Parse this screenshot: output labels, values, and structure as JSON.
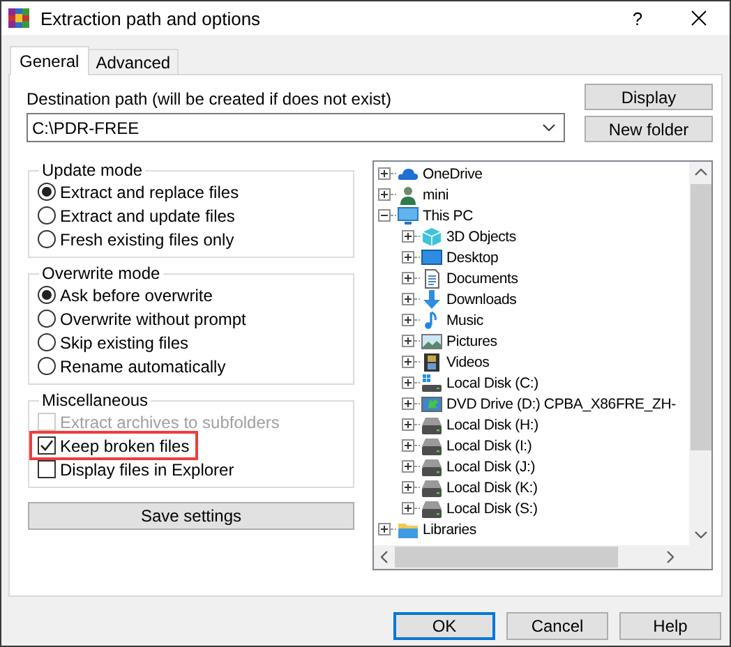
{
  "window": {
    "title": "Extraction path and options",
    "help": "?"
  },
  "tabs": [
    {
      "label": "General",
      "selected": true
    },
    {
      "label": "Advanced",
      "selected": false
    }
  ],
  "destination": {
    "label": "Destination path (will be created if does not exist)",
    "value": "C:\\PDR-FREE"
  },
  "side_buttons": [
    "Display",
    "New folder"
  ],
  "groups": [
    {
      "title": "Update mode",
      "kind": "radio",
      "options": [
        {
          "label": "Extract and replace files",
          "selected": true
        },
        {
          "label": "Extract and update files",
          "selected": false
        },
        {
          "label": "Fresh existing files only",
          "selected": false
        }
      ]
    },
    {
      "title": "Overwrite mode",
      "kind": "radio",
      "options": [
        {
          "label": "Ask before overwrite",
          "selected": true
        },
        {
          "label": "Overwrite without prompt",
          "selected": false
        },
        {
          "label": "Skip existing files",
          "selected": false
        },
        {
          "label": "Rename automatically",
          "selected": false
        }
      ]
    },
    {
      "title": "Miscellaneous",
      "kind": "checkbox",
      "options": [
        {
          "label": "Extract archives to subfolders",
          "checked": false,
          "disabled": true,
          "highlighted": false
        },
        {
          "label": "Keep broken files",
          "checked": true,
          "disabled": false,
          "highlighted": true
        },
        {
          "label": "Display files in Explorer",
          "checked": false,
          "disabled": false,
          "highlighted": false
        }
      ]
    }
  ],
  "save_button": "Save settings",
  "tree": {
    "items": [
      {
        "label": "OneDrive",
        "kind": "cloud",
        "expanded": false
      },
      {
        "label": "mini",
        "kind": "user",
        "expanded": false
      },
      {
        "label": "This PC",
        "kind": "computer",
        "expanded": true,
        "children": [
          {
            "label": "3D Objects",
            "kind": "cube",
            "expanded": false
          },
          {
            "label": "Desktop",
            "kind": "desktop",
            "expanded": false
          },
          {
            "label": "Documents",
            "kind": "document",
            "expanded": false
          },
          {
            "label": "Downloads",
            "kind": "download",
            "expanded": false
          },
          {
            "label": "Music",
            "kind": "music",
            "expanded": false
          },
          {
            "label": "Pictures",
            "kind": "picture",
            "expanded": false
          },
          {
            "label": "Videos",
            "kind": "video",
            "expanded": false
          },
          {
            "label": "Local Disk (C:)",
            "kind": "system-drive",
            "expanded": false
          },
          {
            "label": "DVD Drive (D:) CPBA_X86FRE_ZH-",
            "kind": "dvd",
            "expanded": false
          },
          {
            "label": "Local Disk (H:)",
            "kind": "drive",
            "expanded": false
          },
          {
            "label": "Local Disk (I:)",
            "kind": "drive",
            "expanded": false
          },
          {
            "label": "Local Disk (J:)",
            "kind": "drive",
            "expanded": false
          },
          {
            "label": "Local Disk (K:)",
            "kind": "drive",
            "expanded": false
          },
          {
            "label": "Local Disk (S:)",
            "kind": "drive",
            "expanded": false
          }
        ]
      },
      {
        "label": "Libraries",
        "kind": "folder",
        "expanded": false
      }
    ]
  },
  "buttons": [
    {
      "label": "OK",
      "default": true
    },
    {
      "label": "Cancel",
      "default": false
    },
    {
      "label": "Help",
      "default": false
    }
  ]
}
